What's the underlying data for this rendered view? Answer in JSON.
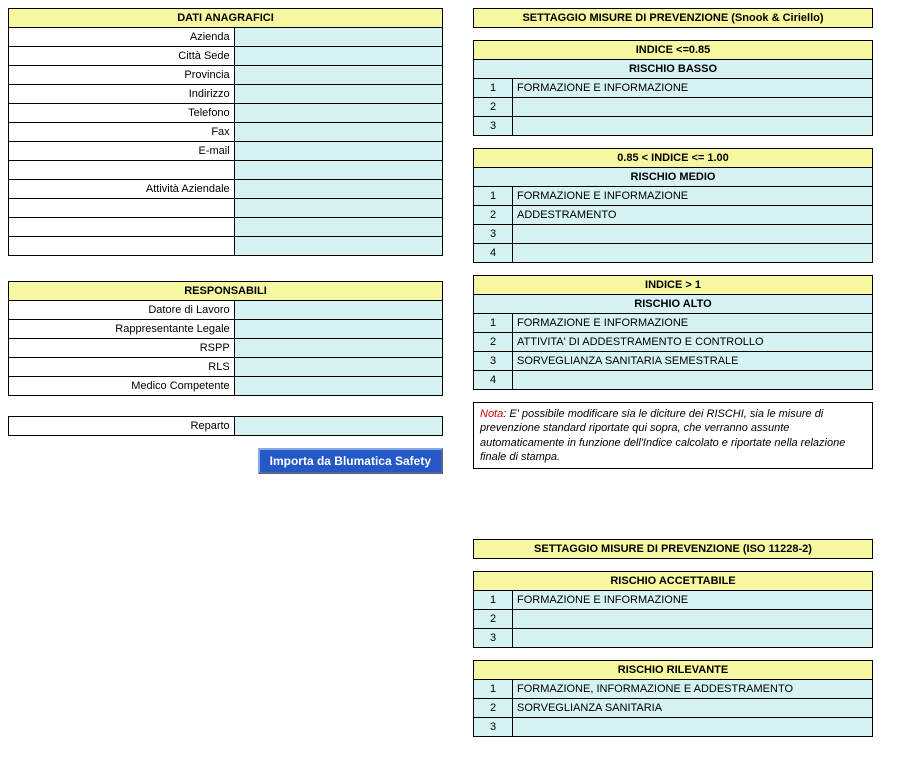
{
  "dati_anagrafici": {
    "header": "DATI ANAGRAFICI",
    "fields": {
      "azienda": "Azienda",
      "citta_sede": "Città Sede",
      "provincia": "Provincia",
      "indirizzo": "Indirizzo",
      "telefono": "Telefono",
      "fax": "Fax",
      "email": "E-mail",
      "attivita": "Attività Aziendale"
    },
    "values": {
      "azienda": "",
      "citta_sede": "",
      "provincia": "",
      "indirizzo": "",
      "telefono": "",
      "fax": "",
      "email": "",
      "attivita": "",
      "extra1": "",
      "extra2": "",
      "extra3": "",
      "extra4": ""
    }
  },
  "responsabili": {
    "header": "RESPONSABILI",
    "fields": {
      "datore": "Datore di Lavoro",
      "rappr": "Rappresentante Legale",
      "rspp": "RSPP",
      "rls": "RLS",
      "medico": "Medico Competente"
    },
    "values": {
      "datore": "",
      "rappr": "",
      "rspp": "",
      "rls": "",
      "medico": ""
    }
  },
  "reparto": {
    "label": "Reparto",
    "value": ""
  },
  "import_button": "Importa da Blumatica Safety",
  "settaggio_snook": {
    "header": "SETTAGGIO MISURE DI PREVENZIONE (Snook & Ciriello)",
    "basso": {
      "indice": "INDICE <=0.85",
      "rischio": "RISCHIO BASSO",
      "rows": {
        "1": "FORMAZIONE E INFORMAZIONE",
        "2": "",
        "3": ""
      }
    },
    "medio": {
      "indice": "0.85 < INDICE <= 1.00",
      "rischio": "RISCHIO MEDIO",
      "rows": {
        "1": "FORMAZIONE E INFORMAZIONE",
        "2": "ADDESTRAMENTO",
        "3": "",
        "4": ""
      }
    },
    "alto": {
      "indice": "INDICE > 1",
      "rischio": "RISCHIO ALTO",
      "rows": {
        "1": "FORMAZIONE E INFORMAZIONE",
        "2": "ATTIVITA' DI ADDESTRAMENTO E CONTROLLO",
        "3": "SORVEGLIANZA SANITARIA SEMESTRALE",
        "4": ""
      }
    }
  },
  "nota": {
    "label": "Nota",
    "text": ": E' possibile modificare sia le diciture dei RISCHI, sia le misure di prevenzione standard riportate qui sopra, che verranno assunte automaticamente in funzione dell'Indice calcolato e riportate nella relazione finale di stampa."
  },
  "settaggio_iso": {
    "header": "SETTAGGIO MISURE DI PREVENZIONE (ISO 11228-2)",
    "accettabile": {
      "rischio": "RISCHIO ACCETTABILE",
      "rows": {
        "1": "FORMAZIONE E INFORMAZIONE",
        "2": "",
        "3": ""
      }
    },
    "rilevante": {
      "rischio": "RISCHIO RILEVANTE",
      "rows": {
        "1": "FORMAZIONE, INFORMAZIONE E ADDESTRAMENTO",
        "2": "SORVEGLIANZA SANITARIA",
        "3": ""
      }
    }
  },
  "nums": {
    "1": "1",
    "2": "2",
    "3": "3",
    "4": "4"
  }
}
